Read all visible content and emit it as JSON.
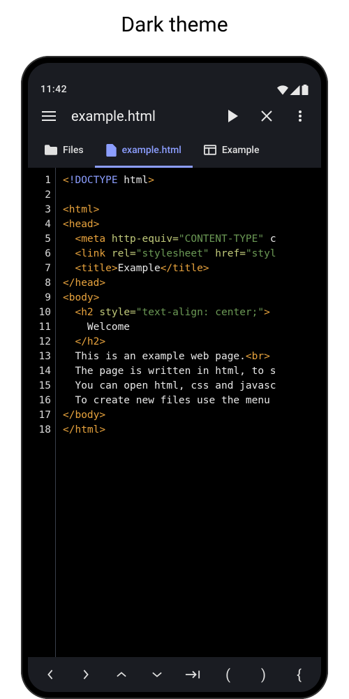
{
  "page_title": "Dark theme",
  "status": {
    "time": "11:42"
  },
  "appbar": {
    "title": "example.html"
  },
  "tabs": {
    "files": "Files",
    "doc": "example.html",
    "preview": "Example"
  },
  "code": {
    "lines": [
      {
        "n": "1",
        "seg": [
          [
            "t-tag",
            "<"
          ],
          [
            "t-doctype",
            "!DOCTYPE"
          ],
          [
            "t-text",
            " html"
          ],
          [
            "t-tag",
            ">"
          ]
        ]
      },
      {
        "n": "2",
        "seg": []
      },
      {
        "n": "3",
        "seg": [
          [
            "t-tag",
            "<html>"
          ]
        ]
      },
      {
        "n": "4",
        "seg": [
          [
            "t-tag",
            "<head>"
          ]
        ]
      },
      {
        "n": "5",
        "seg": [
          [
            "t-text",
            "  "
          ],
          [
            "t-tag",
            "<meta"
          ],
          [
            "t-text",
            " "
          ],
          [
            "t-attr",
            "http-equiv="
          ],
          [
            "t-string",
            "\"CONTENT-TYPE\""
          ],
          [
            "t-text",
            " c"
          ]
        ]
      },
      {
        "n": "6",
        "seg": [
          [
            "t-text",
            "  "
          ],
          [
            "t-tag",
            "<link"
          ],
          [
            "t-text",
            " "
          ],
          [
            "t-attr",
            "rel="
          ],
          [
            "t-string",
            "\"stylesheet\""
          ],
          [
            "t-text",
            " "
          ],
          [
            "t-attr",
            "href="
          ],
          [
            "t-string",
            "\"styl"
          ]
        ]
      },
      {
        "n": "7",
        "seg": [
          [
            "t-text",
            "  "
          ],
          [
            "t-tag",
            "<title>"
          ],
          [
            "t-text",
            "Example"
          ],
          [
            "t-tag",
            "</title>"
          ]
        ]
      },
      {
        "n": "8",
        "seg": [
          [
            "t-tag",
            "</head>"
          ]
        ]
      },
      {
        "n": "9",
        "seg": [
          [
            "t-tag",
            "<body>"
          ]
        ]
      },
      {
        "n": "10",
        "seg": [
          [
            "t-text",
            "  "
          ],
          [
            "t-tag",
            "<h2"
          ],
          [
            "t-text",
            " "
          ],
          [
            "t-attr",
            "style="
          ],
          [
            "t-string",
            "\"text-align: center;\""
          ],
          [
            "t-tag",
            ">"
          ]
        ]
      },
      {
        "n": "11",
        "seg": [
          [
            "t-text",
            "    Welcome"
          ]
        ]
      },
      {
        "n": "12",
        "seg": [
          [
            "t-text",
            "  "
          ],
          [
            "t-tag",
            "</h2>"
          ]
        ]
      },
      {
        "n": "13",
        "seg": [
          [
            "t-text",
            "  This is an example web page."
          ],
          [
            "t-tag",
            "<br>"
          ]
        ]
      },
      {
        "n": "14",
        "seg": [
          [
            "t-text",
            "  The page is written in html, to s"
          ]
        ]
      },
      {
        "n": "15",
        "seg": [
          [
            "t-text",
            "  You can open html, css and javasc"
          ]
        ]
      },
      {
        "n": "16",
        "seg": [
          [
            "t-text",
            "  To create new files use the menu "
          ]
        ]
      },
      {
        "n": "17",
        "seg": [
          [
            "t-tag",
            "</body>"
          ]
        ]
      },
      {
        "n": "18",
        "seg": [
          [
            "t-tag",
            "</html>"
          ]
        ]
      }
    ]
  },
  "bottombar": {
    "prev": "‹",
    "next": "›",
    "up": "˄",
    "down": "˅",
    "tab": "→|",
    "lparen": "(",
    "rparen": ")",
    "lbrace": "{"
  }
}
